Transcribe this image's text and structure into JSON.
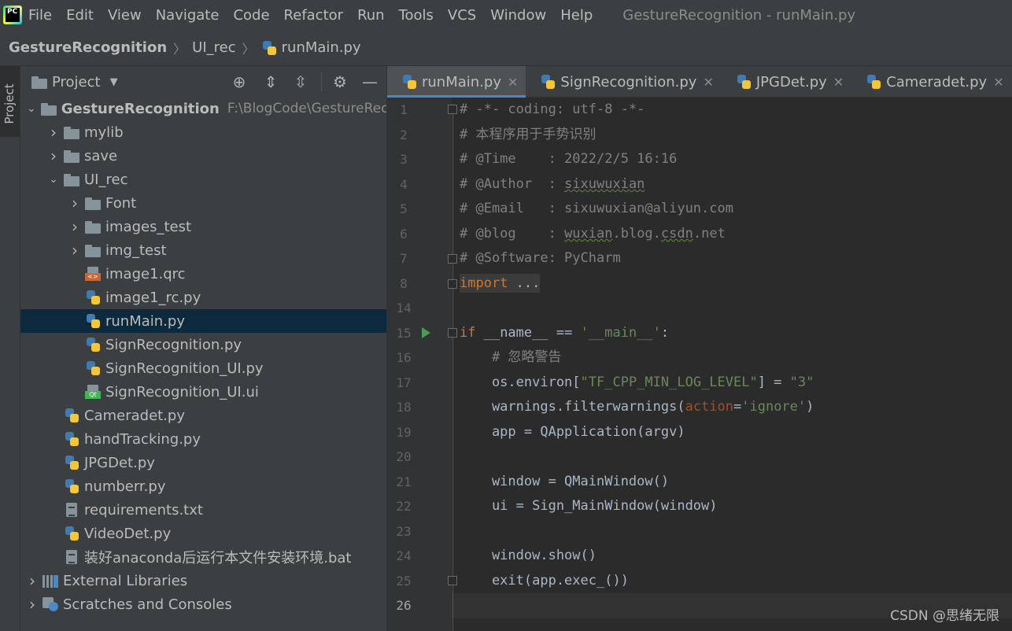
{
  "menubar": {
    "logo_text": "PC",
    "items": [
      "File",
      "Edit",
      "View",
      "Navigate",
      "Code",
      "Refactor",
      "Run",
      "Tools",
      "VCS",
      "Window",
      "Help"
    ],
    "window_title": "GestureRecognition - runMain.py"
  },
  "breadcrumb": [
    "GestureRecognition",
    "UI_rec",
    "runMain.py"
  ],
  "tool_strip": {
    "project_label": "Project"
  },
  "project_panel": {
    "title": "Project",
    "tree": [
      {
        "label": "GestureRecognition",
        "path": "F:\\BlogCode\\GestureRecognition",
        "icon": "folder-icon",
        "expanded": true
      },
      {
        "label": "mylib",
        "icon": "folder-icon"
      },
      {
        "label": "save",
        "icon": "folder-icon"
      },
      {
        "label": "UI_rec",
        "icon": "folder-icon",
        "expanded": true
      },
      {
        "label": "Font",
        "icon": "folder-icon"
      },
      {
        "label": "images_test",
        "icon": "folder-icon"
      },
      {
        "label": "img_test",
        "icon": "folder-icon"
      },
      {
        "label": "image1.qrc",
        "icon": "qrc-icon"
      },
      {
        "label": "image1_rc.py",
        "icon": "python-icon"
      },
      {
        "label": "runMain.py",
        "icon": "python-icon",
        "selected": true
      },
      {
        "label": "SignRecognition.py",
        "icon": "python-icon"
      },
      {
        "label": "SignRecognition_UI.py",
        "icon": "python-icon"
      },
      {
        "label": "SignRecognition_UI.ui",
        "icon": "ui-icon"
      },
      {
        "label": "Cameradet.py",
        "icon": "python-icon"
      },
      {
        "label": "handTracking.py",
        "icon": "python-icon"
      },
      {
        "label": "JPGDet.py",
        "icon": "python-icon"
      },
      {
        "label": "numberr.py",
        "icon": "python-icon"
      },
      {
        "label": "requirements.txt",
        "icon": "text-icon"
      },
      {
        "label": "VideoDet.py",
        "icon": "python-icon"
      },
      {
        "label": "装好anaconda后运行本文件安装环境.bat",
        "icon": "text-icon"
      },
      {
        "label": "External Libraries",
        "icon": "lib-icon"
      },
      {
        "label": "Scratches and Consoles",
        "icon": "scratch-icon"
      }
    ]
  },
  "editor": {
    "tabs": [
      {
        "label": "runMain.py",
        "active": true
      },
      {
        "label": "SignRecognition.py"
      },
      {
        "label": "JPGDet.py"
      },
      {
        "label": "Cameradet.py"
      }
    ],
    "line_numbers": [
      "1",
      "2",
      "3",
      "4",
      "5",
      "6",
      "7",
      "8",
      "14",
      "15",
      "16",
      "17",
      "18",
      "19",
      "20",
      "21",
      "22",
      "23",
      "24",
      "25",
      "26"
    ],
    "code": {
      "l1": "# -*- coding: utf-8 -*-",
      "l2": "# 本程序用于手势识别",
      "l3": "# @Time    : 2022/2/5 16:16",
      "l4a": "# @Author  : ",
      "l4b": "sixuwuxian",
      "l5": "# @Email   : sixuwuxian@aliyun.com",
      "l6a": "# @blog    : ",
      "l6b": "wuxian",
      "l6c": ".blog.",
      "l6d": "csdn",
      "l6e": ".net",
      "l7": "# @Software: PyCharm",
      "l8a": "import",
      "l8b": " ...",
      "l15a": "if",
      "l15b": " __name__",
      "l15c": " == ",
      "l15d": "'__main__'",
      "l15e": ":",
      "l16": "    # 忽略警告",
      "l17a": "    os.environ[",
      "l17b": "\"TF_CPP_MIN_LOG_LEVEL\"",
      "l17c": "] = ",
      "l17d": "\"3\"",
      "l18a": "    warnings.filterwarnings(",
      "l18b": "action",
      "l18c": "=",
      "l18d": "'ignore'",
      "l18e": ")",
      "l19": "    app = QApplication(argv)",
      "l21": "    window = QMainWindow()",
      "l22": "    ui = Sign_MainWindow(window)",
      "l24": "    window.show()",
      "l25": "    exit(app.exec_())"
    }
  },
  "watermark": "CSDN @思绪无限",
  "colors": {
    "accent": "#4a88c7",
    "selection": "#0d293e",
    "comment": "#808080",
    "keyword": "#cc7832",
    "string": "#6a8759"
  }
}
